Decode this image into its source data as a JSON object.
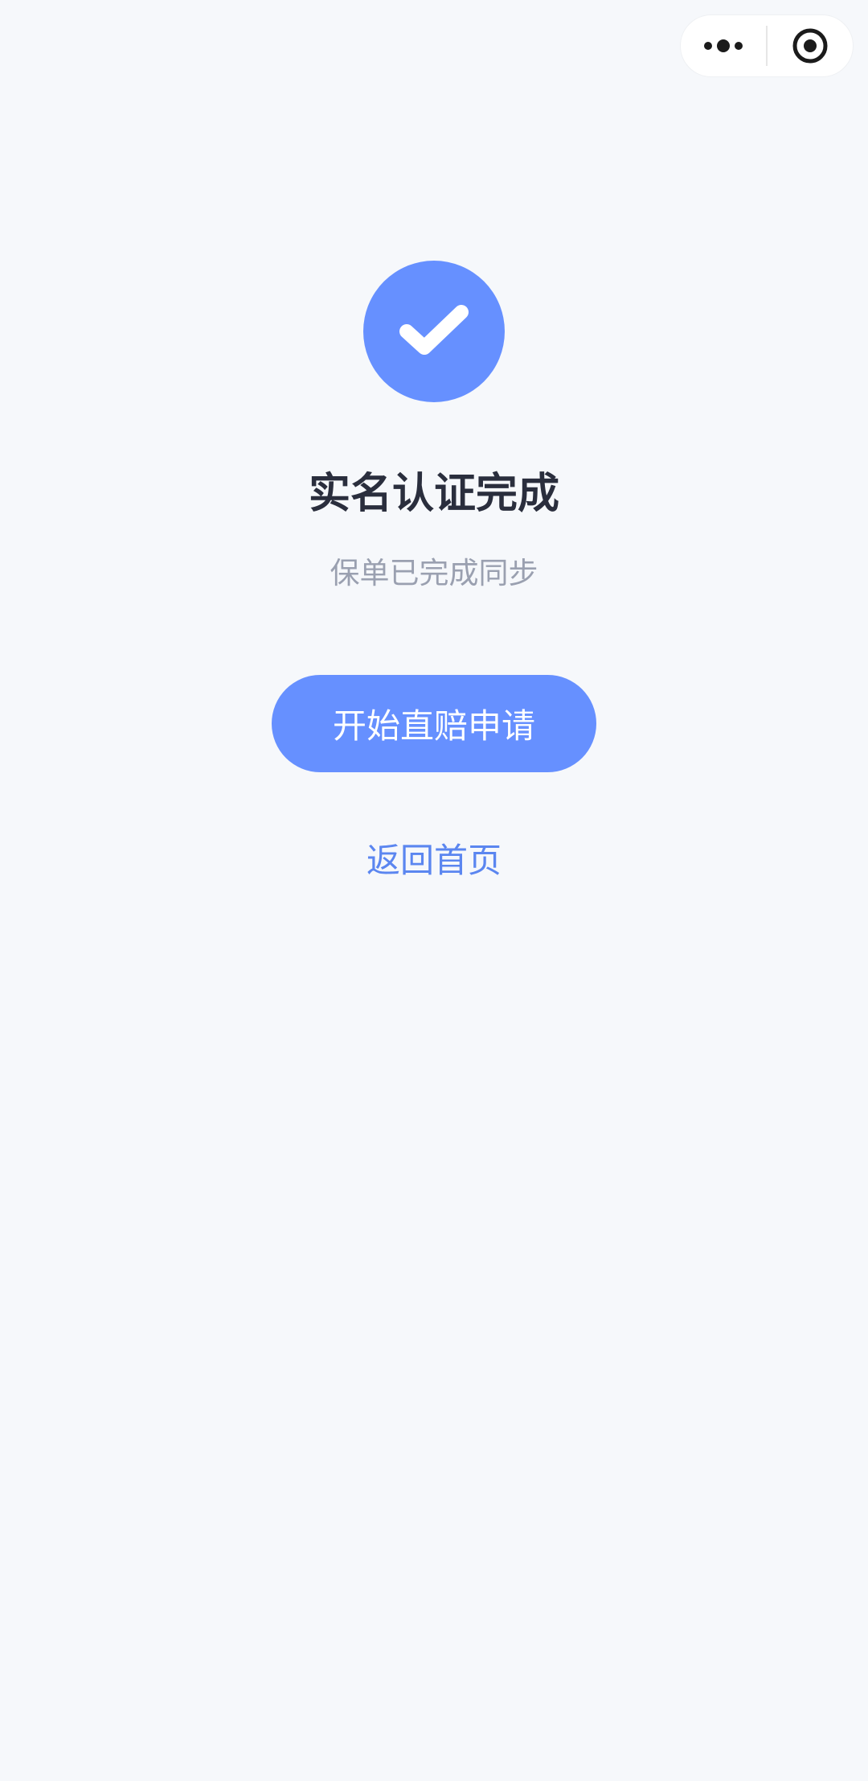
{
  "header": {
    "capsule": {
      "more_icon": "more-dots-icon",
      "close_icon": "target-circle-icon"
    }
  },
  "result": {
    "status_icon": "check-circle-icon",
    "title": "实名认证完成",
    "subtitle": "保单已完成同步"
  },
  "actions": {
    "primary_label": "开始直赔申请",
    "secondary_label": "返回首页"
  },
  "colors": {
    "accent": "#6690ff",
    "link": "#5b86f0",
    "background": "#f6f8fb",
    "title": "#2a2e3d",
    "subtitle": "#9aa0b0"
  }
}
